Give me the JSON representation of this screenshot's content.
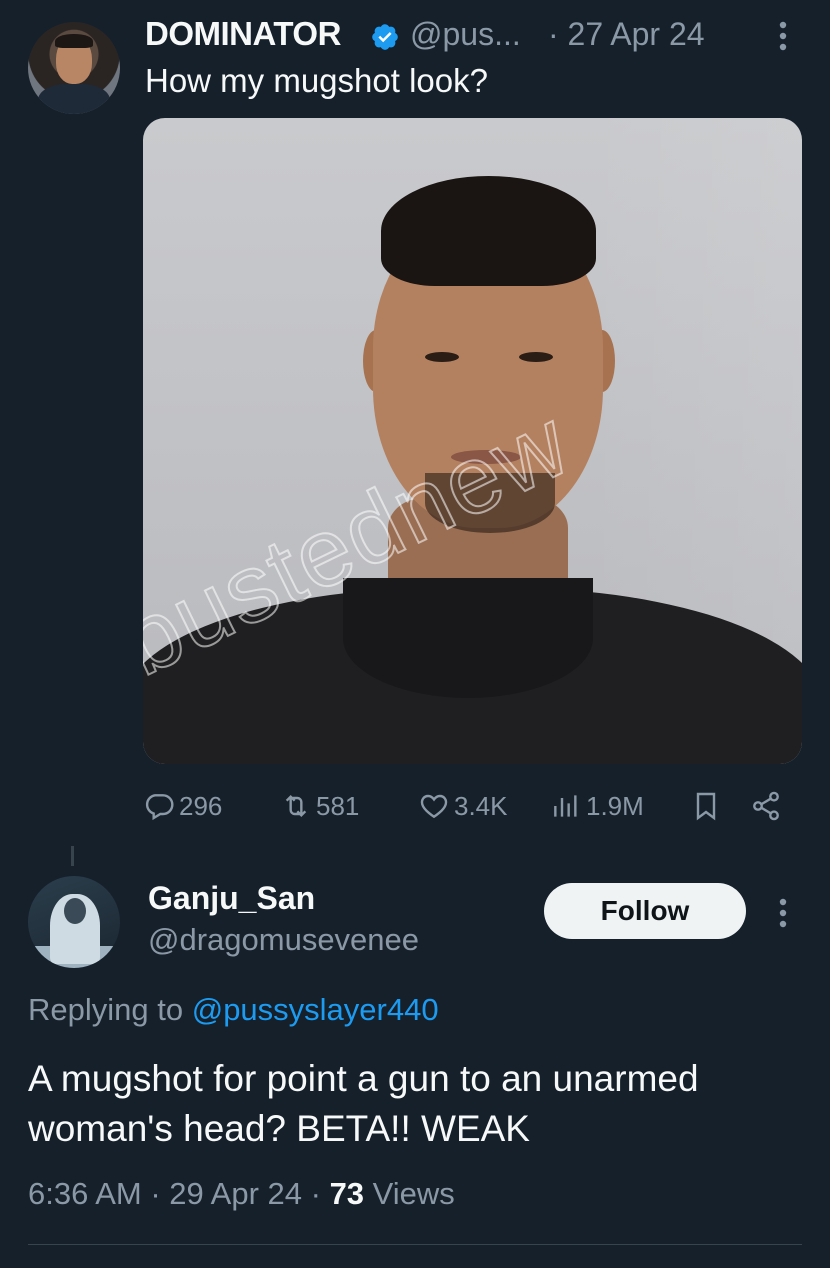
{
  "tweet": {
    "author_name": "DOMINATOR",
    "handle": "@pus...",
    "date": "· 27 Apr 24",
    "text": "How my mugshot look?",
    "media_watermark": "bustednew",
    "icons": {
      "verified": "verified-badge-icon",
      "more": "more-vertical-icon"
    },
    "metrics": {
      "replies": "296",
      "reposts": "581",
      "likes": "3.4K",
      "views": "1.9M"
    }
  },
  "reply": {
    "author_name": "Ganju_San",
    "handle": "@dragomusevenee",
    "follow_label": "Follow",
    "replying_to_prefix": "Replying to",
    "replying_to_mention": "@pussyslayer440",
    "text": "A mugshot for point a gun to an unarmed woman's head? BETA!! WEAK",
    "time": "6:36 AM · 29 Apr 24 · ",
    "views_count": "73",
    "views_label": " Views"
  },
  "colors": {
    "background": "#15202b",
    "text_primary": "#f7f9f9",
    "text_secondary": "#8b98a5",
    "accent_blue": "#1d9bf0",
    "follow_button_bg": "#eff3f4"
  }
}
